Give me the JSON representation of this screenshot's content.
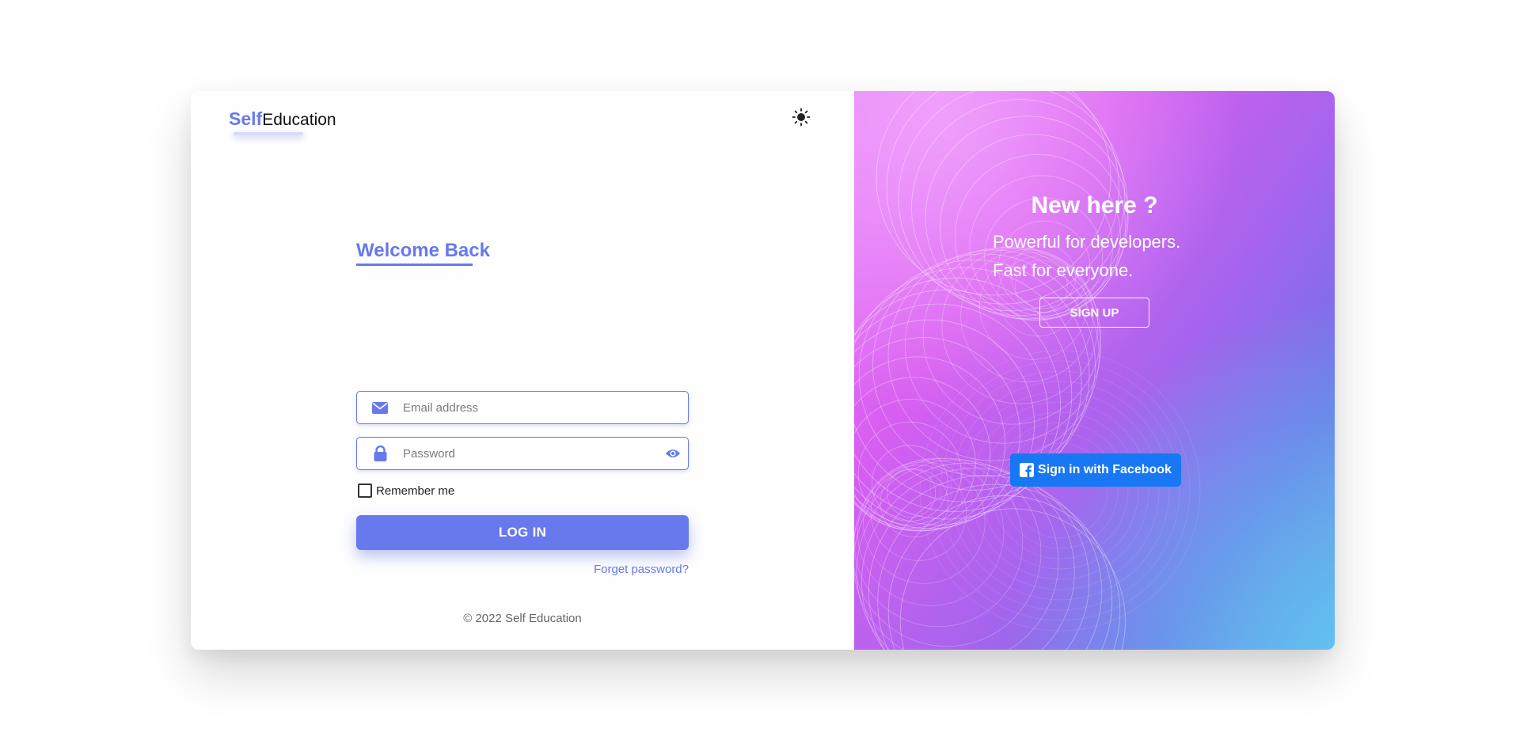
{
  "brand": {
    "part1": "Self",
    "part2": "Education"
  },
  "theme_toggle": {
    "icon": "sun-icon"
  },
  "login_form": {
    "heading": "Welcome Back",
    "email": {
      "icon": "envelope-icon",
      "placeholder": "Email address",
      "value": ""
    },
    "password": {
      "icon": "lock-icon",
      "placeholder": "Password",
      "value": "",
      "toggle_icon": "eye-icon"
    },
    "remember_label": "Remember me",
    "remember_checked": false,
    "login_label": "LOG IN",
    "forgot_label": "Forget password?"
  },
  "footer": {
    "copyright": "© 2022 Self Education"
  },
  "signup_panel": {
    "heading": "New here ?",
    "tagline_line1": "Powerful for developers.",
    "tagline_line2": "Fast for everyone.",
    "signup_label": "SIGN UP",
    "facebook_label": "Sign in with Facebook",
    "facebook_icon": "facebook-icon"
  },
  "colors": {
    "accent": "#6779ec",
    "facebook": "#1877f2",
    "panel_gradient": [
      "#e77cf8",
      "#d85ef0",
      "#a664ee",
      "#7072e8",
      "#5fcdf0"
    ]
  }
}
